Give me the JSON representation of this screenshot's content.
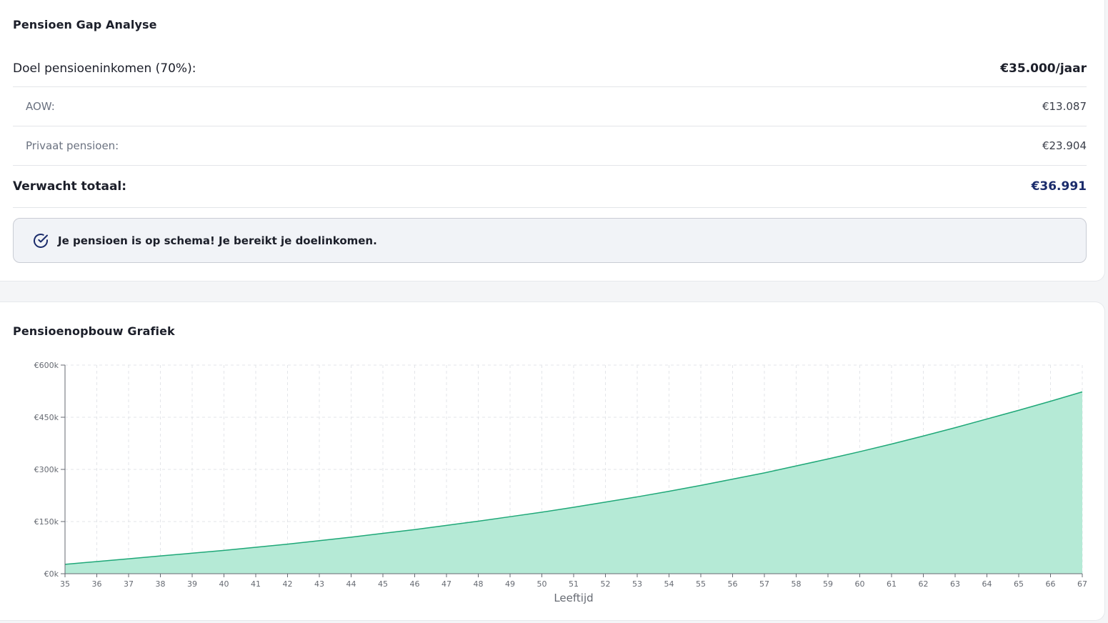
{
  "gap_analysis": {
    "title": "Pensioen Gap Analyse",
    "target": {
      "label": "Doel pensioeninkomen (70%):",
      "value": "€35.000/jaar"
    },
    "aow": {
      "label": "AOW:",
      "value": "€13.087"
    },
    "private": {
      "label": "Privaat pensioen:",
      "value": "€23.904"
    },
    "total": {
      "label": "Verwacht totaal:",
      "value": "€36.991"
    },
    "alert": {
      "icon": "check-circle-icon",
      "text": "Je pensioen is op schema! Je bereikt je doelinkomen."
    }
  },
  "chart_section": {
    "title": "Pensioenopbouw Grafiek"
  },
  "colors": {
    "accent": "#1a2b6b",
    "area_fill": "#b5ead6",
    "area_stroke": "#1fa878"
  },
  "chart_data": {
    "type": "area",
    "title": "",
    "xlabel": "Leeftijd",
    "ylabel": "",
    "x": [
      35,
      36,
      37,
      38,
      39,
      40,
      41,
      42,
      43,
      44,
      45,
      46,
      47,
      48,
      49,
      50,
      51,
      52,
      53,
      54,
      55,
      56,
      57,
      58,
      59,
      60,
      61,
      62,
      63,
      64,
      65,
      66,
      67
    ],
    "series": [
      {
        "values": [
          27000,
          35000,
          43000,
          51000,
          59000,
          67000,
          76000,
          85000,
          95000,
          105000,
          116000,
          127000,
          139000,
          151000,
          164000,
          177000,
          191000,
          206000,
          221000,
          237000,
          254000,
          272000,
          290000,
          310000,
          330000,
          351000,
          373000,
          396000,
          420000,
          445000,
          470000,
          496000,
          523000
        ]
      }
    ],
    "ylim": [
      0,
      600000
    ],
    "yticks": [
      0,
      150000,
      300000,
      450000,
      600000
    ],
    "ytick_labels": [
      "€0k",
      "€150k",
      "€300k",
      "€450k",
      "€600k"
    ],
    "grid": true
  }
}
